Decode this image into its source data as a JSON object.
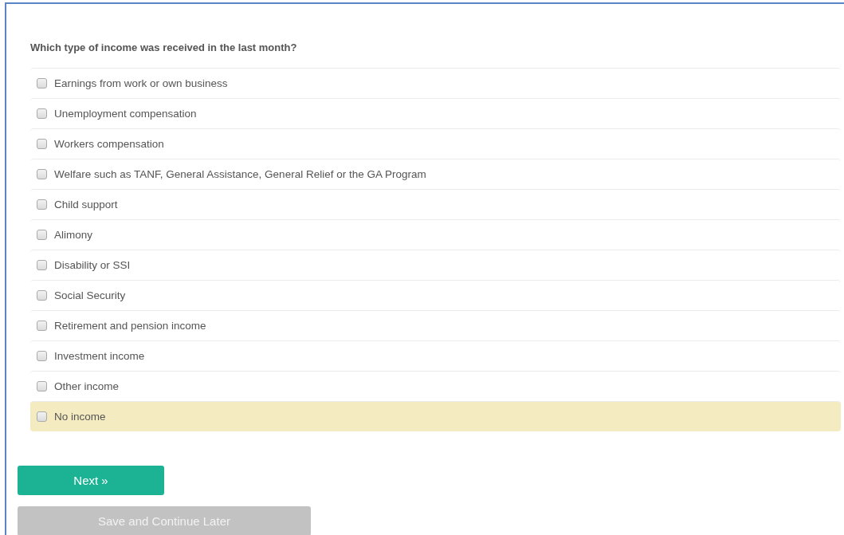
{
  "question": "Which type of income was received in the last month?",
  "options": [
    {
      "label": "Earnings from work or own business",
      "checked": false,
      "highlighted": false
    },
    {
      "label": "Unemployment compensation",
      "checked": false,
      "highlighted": false
    },
    {
      "label": "Workers compensation",
      "checked": false,
      "highlighted": false
    },
    {
      "label": "Welfare such as TANF, General Assistance, General Relief or the GA Program",
      "checked": false,
      "highlighted": false
    },
    {
      "label": "Child support",
      "checked": false,
      "highlighted": false
    },
    {
      "label": "Alimony",
      "checked": false,
      "highlighted": false
    },
    {
      "label": "Disability or SSI",
      "checked": false,
      "highlighted": false
    },
    {
      "label": "Social Security",
      "checked": false,
      "highlighted": false
    },
    {
      "label": "Retirement and pension income",
      "checked": false,
      "highlighted": false
    },
    {
      "label": "Investment income",
      "checked": false,
      "highlighted": false
    },
    {
      "label": "Other income",
      "checked": false,
      "highlighted": false
    },
    {
      "label": "No income",
      "checked": false,
      "highlighted": true
    }
  ],
  "buttons": [
    {
      "label": "Next »",
      "kind": "primary",
      "disabled": false
    },
    {
      "label": "Save and Continue Later",
      "kind": "secondary",
      "disabled": true
    }
  ]
}
